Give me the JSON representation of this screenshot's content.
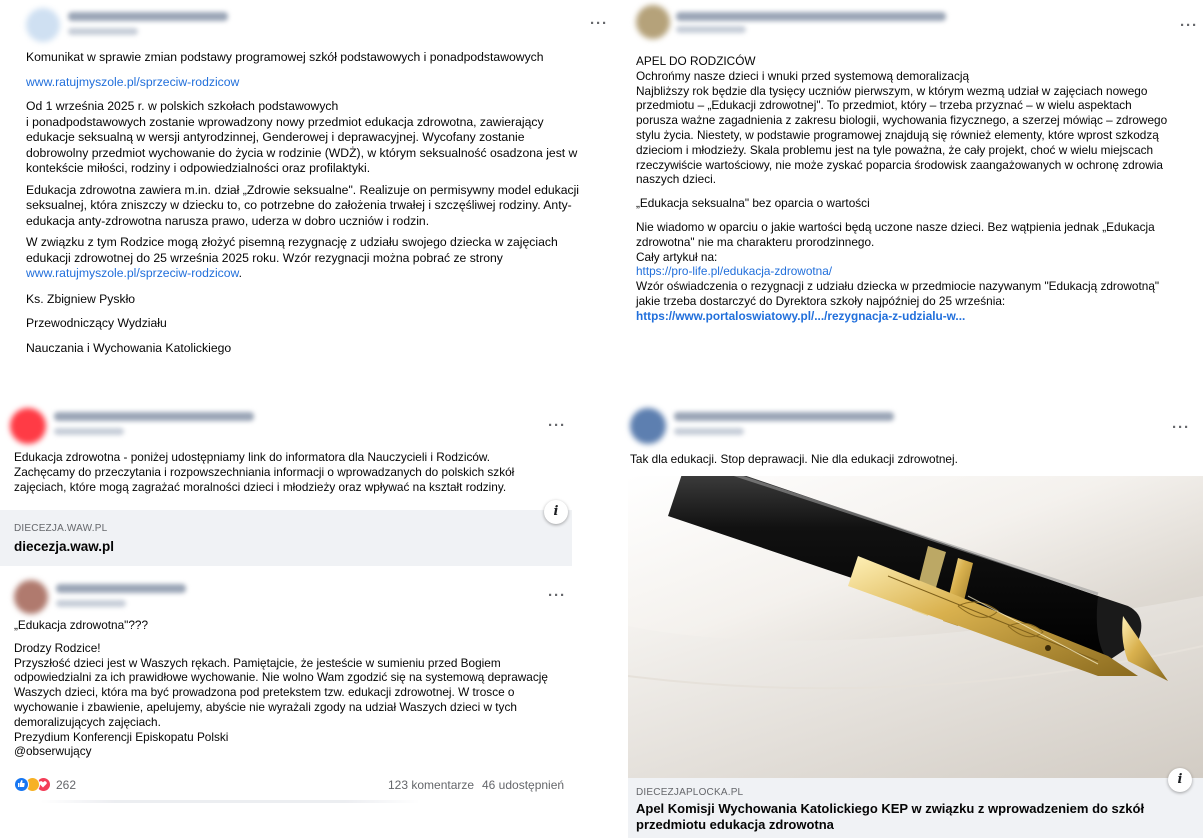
{
  "posts": {
    "p1": {
      "more": "···",
      "headline": "Komunikat w sprawie zmian podstawy programowej szkół podstawowych i ponadpodstawowych",
      "link1": "www.ratujmyszole.pl/sprzeciw-rodzicow",
      "para1_l1": "Od 1 września 2025 r. w polskich szkołach podstawowych",
      "para1_l2": "i ponadpodstawowych zostanie wprowadzony nowy przedmiot edukacja zdrowotna, zawierający",
      "para1_l3": "edukacje seksualną w wersji antyrodzinnej, Genderowej i deprawacyjnej. Wycofany zostanie",
      "para1_l4": "dobrowolny przedmiot wychowanie do życia w rodzinie (WDŻ), w którym seksualność osadzona jest w",
      "para1_l5": "kontekście miłości, rodziny i odpowiedzialności oraz profilaktyki.",
      "para2_l1": "Edukacja zdrowotna zawiera m.in. dział „Zdrowie seksualne\". Realizuje on permisywny model edukacji",
      "para2_l2": "seksualnej, która zniszczy w dziecku to, co potrzebne do założenia trwałej i szczęśliwej rodziny. Anty-",
      "para2_l3": "edukacja anty-zdrowotna narusza prawo, uderza w dobro uczniów i rodzin.",
      "para3_l1": "W związku z tym Rodzice mogą złożyć pisemną rezygnację z udziału swojego dziecka w zajęciach",
      "para3_l2": "edukacji zdrowotnej do 25 września 2025 roku. Wzór rezygnacji można pobrać ze strony",
      "link2": "www.ratujmyszole.pl/sprzeciw-rodzicow",
      "link2_suffix": ".",
      "sig1": "Ks. Zbigniew Pyskło",
      "sig2": "Przewodniczący Wydziału",
      "sig3": "Nauczania i Wychowania Katolickiego"
    },
    "p2": {
      "more": "···",
      "l1": "APEL DO RODZICÓW",
      "l2": "Ochrońmy nasze dzieci i wnuki przed systemową demoralizacją",
      "l3": "Najbliższy rok będzie dla tysięcy uczniów pierwszym, w którym wezmą udział w zajęciach nowego",
      "l4": "przedmiotu – „Edukacji zdrowotnej\". To przedmiot, który – trzeba przyznać – w wielu aspektach",
      "l5": "porusza ważne zagadnienia z zakresu biologii, wychowania fizycznego, a szerzej mówiąc – zdrowego",
      "l6": "stylu życia. Niestety, w podstawie programowej znajdują się również elementy, które wprost szkodzą",
      "l7": "dzieciom i młodzieży. Skala problemu jest na tyle poważna, że cały projekt, choć w wielu miejscach",
      "l8": "rzeczywiście wartościowy, nie może zyskać poparcia środowisk zaangażowanych w ochronę zdrowia",
      "l9": "naszych dzieci.",
      "l10": "„Edukacja seksualna\" bez oparcia o wartości",
      "l11": "Nie wiadomo w oparciu o jakie wartości będą uczone nasze dzieci. Bez wątpienia jednak „Edukacja",
      "l12": "zdrowotna\" nie ma charakteru prorodzinnego.",
      "l13": "Cały artykuł na:",
      "link1": "https://pro-life.pl/edukacja-zdrowotna/",
      "l14": "Wzór oświadczenia o rezygnacji z udziału dziecka w przedmiocie nazywanym \"Edukacją zdrowotną\"",
      "l15": "jakie trzeba dostarczyć do Dyrektora szkoły najpóźniej do 25 września:",
      "link2": "https://www.portaloswiatowy.pl/.../rezygnacja-z-udzialu-w..."
    },
    "p3": {
      "more": "···",
      "l1": "Edukacja zdrowotna - poniżej udostępniamy link do informatora dla Nauczycieli i Rodziców.",
      "l2": "Zachęcamy do przeczytania i rozpowszechniania informacji o wprowadzanych do polskich szkół",
      "l3": "zajęciach, które mogą zagrażać moralności dzieci i młodzieży oraz wpływać na  kształt rodziny.",
      "card_domain": "DIECEZJA.WAW.PL",
      "card_title": "diecezja.waw.pl",
      "info": "i"
    },
    "p4": {
      "more": "···",
      "l1": "„Edukacja zdrowotna\"???",
      "l2": "Drodzy Rodzice!",
      "l3": "Przyszłość dzieci jest w Waszych rękach. Pamiętajcie, że jesteście w sumieniu przed Bogiem",
      "l4": "odpowiedzialni za ich prawidłowe wychowanie. Nie wolno Wam zgodzić się na systemową deprawację",
      "l5": "Waszych dzieci, która ma być prowadzona pod pretekstem tzw. edukacji zdrowotnej. W trosce o",
      "l6": "wychowanie i zbawienie, apelujemy, abyście nie wyrażali zgody na udział Waszych dzieci w tych",
      "l7": "demoralizujących zajęciach.",
      "l8": "Prezydium Konferencji Episkopatu Polski",
      "l9": "@obserwujący",
      "reaction_count": "262",
      "comments": "123 komentarze",
      "shares": "46 udostępnień"
    },
    "p5": {
      "more": "···",
      "l1": "Tak dla edukacji. Stop deprawacji. Nie dla edukacji zdrowotnej.",
      "card_domain": "DIECEZJAPLOCKA.PL",
      "card_title_l1": "Apel Komisji Wychowania Katolickiego KEP w związku z wprowadzeniem do szkół",
      "card_title_l2": "przedmiotu edukacja zdrowotna",
      "info": "i"
    }
  },
  "colors": {
    "link": "#216fdb",
    "card_bg": "#f0f2f5",
    "muted": "#65676b",
    "like_blue": "#1877f2",
    "love_red": "#f33e58",
    "haha_yellow": "#f7b125"
  }
}
